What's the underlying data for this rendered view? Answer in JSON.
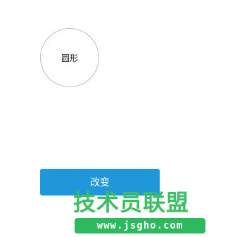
{
  "shape": {
    "label": "圆形"
  },
  "button": {
    "label": "改变",
    "color": "#1f97d8"
  },
  "watermark": {
    "title": "技术员联盟",
    "url": "www.jsgho.com",
    "color": "#2dba5e"
  }
}
